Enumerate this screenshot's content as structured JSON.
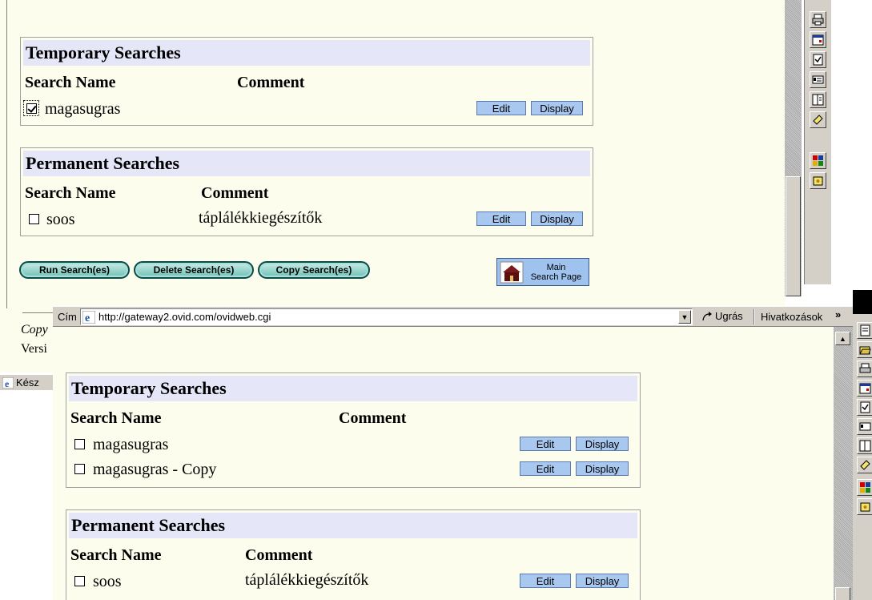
{
  "back_window": {
    "temporary": {
      "title": "Temporary Searches",
      "col_name": "Search Name",
      "col_comment": "Comment",
      "rows": [
        {
          "name": "magasugras",
          "comment": "",
          "checked": true
        }
      ]
    },
    "permanent": {
      "title": "Permanent Searches",
      "col_name": "Search Name",
      "col_comment": "Comment",
      "rows": [
        {
          "name": "soos",
          "comment": "táplálékkiegészítők",
          "checked": false
        }
      ]
    },
    "row_buttons": {
      "edit": "Edit",
      "display": "Display"
    },
    "actions": {
      "run": "Run Search(es)",
      "delete": "Delete Search(es)",
      "copy": "Copy Search(es)",
      "main_search_line1": "Main",
      "main_search_line2": "Search Page"
    },
    "footer": {
      "copyright_fragment": "Copy",
      "version_fragment": "Versi"
    },
    "status_fragment": "Kész"
  },
  "front_window": {
    "address_bar": {
      "label": "Cím",
      "url": "http://gateway2.ovid.com/ovidweb.cgi",
      "go_label": "Ugrás",
      "links_label": "Hivatkozások",
      "more_glyph": "»"
    },
    "temporary": {
      "title": "Temporary Searches",
      "col_name": "Search Name",
      "col_comment": "Comment",
      "rows": [
        {
          "name": "magasugras",
          "comment": "",
          "checked": false
        },
        {
          "name": "magasugras - Copy",
          "comment": "",
          "checked": false
        }
      ]
    },
    "permanent": {
      "title": "Permanent Searches",
      "col_name": "Search Name",
      "col_comment": "Comment",
      "rows": [
        {
          "name": "soos",
          "comment": "táplálékkiegészítők",
          "checked": false
        }
      ]
    },
    "row_buttons": {
      "edit": "Edit",
      "display": "Display"
    }
  },
  "sidebar_icons": [
    "print-icon",
    "calendar-icon",
    "checklist-icon",
    "address-card-icon",
    "document-icon",
    "note-icon",
    "puzzle-icon",
    "folder-icon"
  ],
  "colors": {
    "page_bg": "#fdfdee",
    "panel_header": "#e6e6f9",
    "button_blue": "#a9c8f0"
  }
}
